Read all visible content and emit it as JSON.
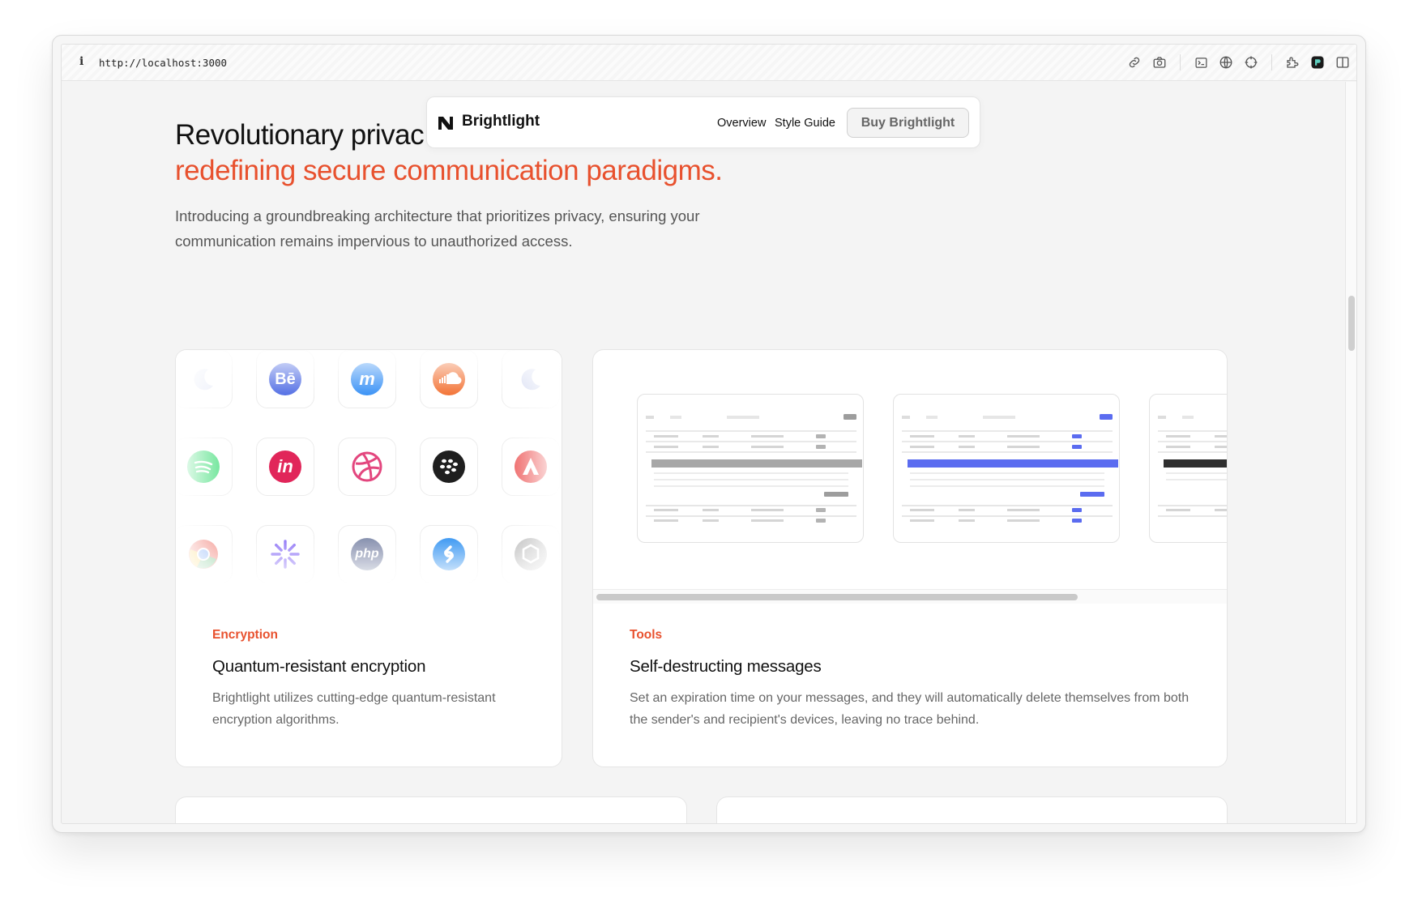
{
  "browser": {
    "info_glyph": "i",
    "url": "http://localhost:3000",
    "icons": [
      "link-icon",
      "camera-icon",
      "terminal-icon",
      "globe-icon",
      "crosshair-icon",
      "extension-icon",
      "app-icon",
      "sidebar-icon"
    ]
  },
  "nav": {
    "brand": "Brightlight",
    "links": [
      "Overview",
      "Style Guide"
    ],
    "cta": "Buy Brightlight"
  },
  "hero": {
    "title_visible": "Revolutionary privac",
    "title_accent": "redefining secure communication paradigms.",
    "subtitle": "Introducing a groundbreaking architecture that prioritizes privacy, ensuring your communication remains impervious to unauthorized access."
  },
  "cards": {
    "encryption": {
      "eyebrow": "Encryption",
      "title": "Quantum-resistant encryption",
      "body": "Brightlight utilizes cutting-edge quantum-resistant encryption algorithms.",
      "icon_grid": [
        [
          "moon-icon",
          "behance-icon",
          "m-logo-icon",
          "soundcloud-icon",
          "moon-icon"
        ],
        [
          "spotify-icon",
          "invision-icon",
          "dribbble-icon",
          "blackberry-icon",
          "arrow-a-icon"
        ],
        [
          "chrome-icon",
          "sparkle-icon",
          "php-icon",
          "shazam-icon",
          "openai-icon"
        ]
      ],
      "icon_text": {
        "behance": "Bē",
        "invision": "in",
        "php": "php"
      }
    },
    "tools": {
      "eyebrow": "Tools",
      "title": "Self-destructing messages",
      "body": "Set an expiration time on your messages, and they will automatically delete themselves from both the sender's and recipient's devices, leaving no trace behind.",
      "screenshots": [
        "table-screenshot-gray",
        "table-screenshot-blue",
        "table-screenshot-dark"
      ]
    }
  },
  "colors": {
    "accent": "#e8512e",
    "text": "#111111",
    "muted": "#666666"
  }
}
